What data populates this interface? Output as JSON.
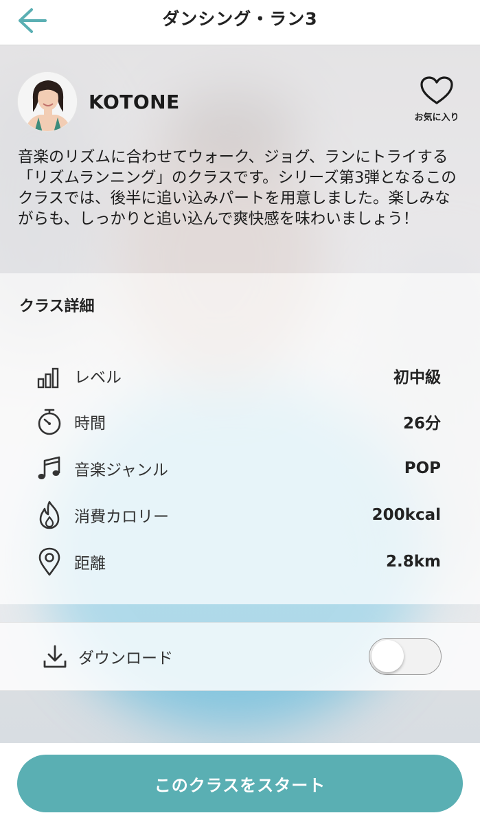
{
  "header": {
    "title": "ダンシング・ラン3"
  },
  "instructor": {
    "name": "KOTONE"
  },
  "favorite": {
    "label": "お気に入り"
  },
  "description": "音楽のリズムに合わせてウォーク、ジョグ、ランにトライする「リズムランニング」のクラスです。シリーズ第3弾となるこのクラスでは、後半に追い込みパートを用意しました。楽しみながらも、しっかりと追い込んで爽快感を味わいましょう！",
  "details": {
    "title": "クラス詳細",
    "items": [
      {
        "icon": "level-bars-icon",
        "label": "レベル",
        "value": "初中級"
      },
      {
        "icon": "stopwatch-icon",
        "label": "時間",
        "value": "26分"
      },
      {
        "icon": "music-note-icon",
        "label": "音楽ジャンル",
        "value": "POP"
      },
      {
        "icon": "flame-icon",
        "label": "消費カロリー",
        "value": "200kcal"
      },
      {
        "icon": "location-pin-icon",
        "label": "距離",
        "value": "2.8km"
      }
    ]
  },
  "download": {
    "label": "ダウンロード",
    "enabled": false
  },
  "start_button": {
    "label": "このクラスをスタート"
  },
  "colors": {
    "accent": "#5aafb3",
    "back_arrow": "#5aafb3"
  }
}
